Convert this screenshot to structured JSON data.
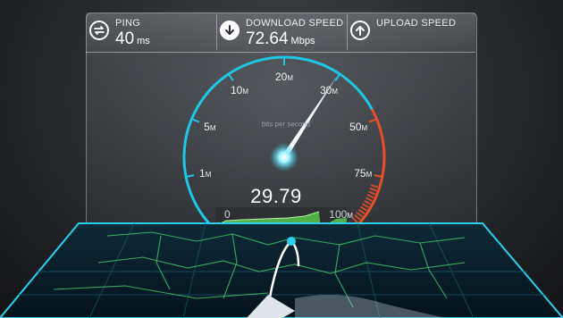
{
  "stats": {
    "ping": {
      "label": "PING",
      "value": "40",
      "unit": "ms",
      "icon": "ping-arrows-icon"
    },
    "download": {
      "label": "DOWNLOAD SPEED",
      "value": "72.64",
      "unit": "Mbps",
      "icon": "arrow-down-icon"
    },
    "upload": {
      "label": "UPLOAD SPEED",
      "value": "",
      "unit": "",
      "icon": "arrow-up-icon"
    }
  },
  "gauge": {
    "scale": [
      {
        "text": "0",
        "suffix": ""
      },
      {
        "text": "1",
        "suffix": "M"
      },
      {
        "text": "5",
        "suffix": "M"
      },
      {
        "text": "10",
        "suffix": "M"
      },
      {
        "text": "20",
        "suffix": "M"
      },
      {
        "text": "30",
        "suffix": "M"
      },
      {
        "text": "50",
        "suffix": "M"
      },
      {
        "text": "75",
        "suffix": "M"
      },
      {
        "text": "100",
        "suffix": "M"
      }
    ],
    "unit_label": "bits per second",
    "reading": "29.79",
    "needle_value_mbps": 29.79,
    "accent_color": "#1ec7e6",
    "high_zone_color": "#e8502a"
  }
}
